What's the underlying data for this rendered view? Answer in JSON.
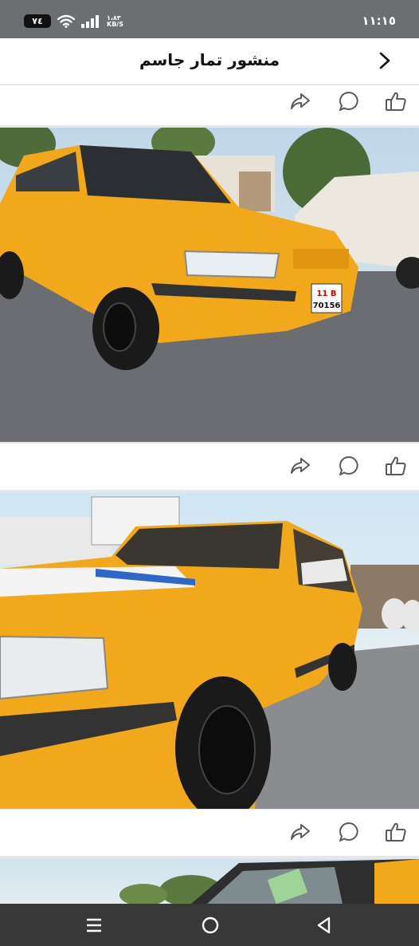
{
  "status": {
    "battery": "٧٤",
    "speed_value": "١،٨٣",
    "speed_unit": "KB/S",
    "time": "١١:١٥"
  },
  "header": {
    "title": "منشور تمار جاسم"
  },
  "icons": {
    "back": "chevron-right-icon",
    "like": "thumbs-up-icon",
    "comment": "comment-bubble-icon",
    "share": "share-arrow-icon",
    "nav_menu": "recent-apps-icon",
    "nav_home": "home-circle-icon",
    "nav_back": "back-triangle-icon"
  },
  "colors": {
    "taxi_yellow": "#f2a81b",
    "background": "#e4e6eb",
    "nav_bar": "#383838"
  },
  "photos": [
    {
      "plate_top": "11 B",
      "plate_bottom": "70156"
    },
    {},
    {}
  ]
}
